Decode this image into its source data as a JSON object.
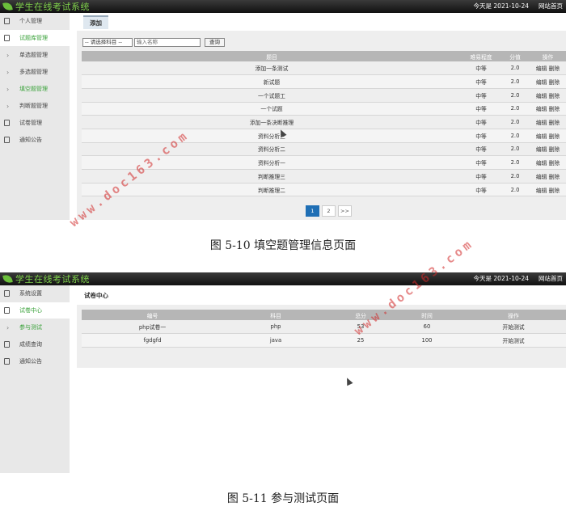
{
  "screen1": {
    "brand": "学生在线考试系统",
    "date_text": "今天是 2021-10-24",
    "site_link": "网站首页",
    "sidebar": [
      {
        "label": "个人管理",
        "type": "group"
      },
      {
        "label": "试题库管理",
        "type": "group",
        "active": true
      },
      {
        "label": "单选题管理",
        "type": "sub"
      },
      {
        "label": "多选题管理",
        "type": "sub"
      },
      {
        "label": "填空题管理",
        "type": "sub",
        "active": true
      },
      {
        "label": "判断题管理",
        "type": "sub"
      },
      {
        "label": "试卷管理",
        "type": "group"
      },
      {
        "label": "通知公告",
        "type": "group"
      }
    ],
    "tab_label": "添加",
    "search": {
      "select_value": "-- 请选择科目 --",
      "input_placeholder": "输入名称",
      "button_label": "查询"
    },
    "table": {
      "headers": [
        "题目",
        "难易程度",
        "分值",
        "操作"
      ],
      "edit_label": "编辑",
      "delete_label": "删除",
      "rows": [
        [
          "添加一条测试",
          "中等",
          "2.0"
        ],
        [
          "新试题",
          "中等",
          "2.0"
        ],
        [
          "一个试题工",
          "中等",
          "2.0"
        ],
        [
          "一个试题",
          "中等",
          "2.0"
        ],
        [
          "添加一条决断推理",
          "中等",
          "2.0"
        ],
        [
          "资料分析三",
          "中等",
          "2.0"
        ],
        [
          "资料分析二",
          "中等",
          "2.0"
        ],
        [
          "资料分析一",
          "中等",
          "2.0"
        ],
        [
          "判断推理三",
          "中等",
          "2.0"
        ],
        [
          "判断推理二",
          "中等",
          "2.0"
        ]
      ]
    },
    "pager": [
      "1",
      "2",
      ">>"
    ],
    "current_page": "1"
  },
  "caption1": "图 5-10 填空题管理信息页面",
  "screen2": {
    "brand": "学生在线考试系统",
    "date_text": "今天是 2021-10-24",
    "site_link": "网站首页",
    "sidebar": [
      {
        "label": "系统设置",
        "type": "group"
      },
      {
        "label": "试卷中心",
        "type": "group",
        "active": true
      },
      {
        "label": "参与测试",
        "type": "sub",
        "active": true
      },
      {
        "label": "成绩查询",
        "type": "group"
      },
      {
        "label": "通知公告",
        "type": "group"
      }
    ],
    "card_title": "试卷中心",
    "table": {
      "headers": [
        "编号",
        "科目",
        "总分",
        "时间",
        "操作"
      ],
      "rows": [
        [
          "php试卷一",
          "php",
          "53",
          "60",
          "开始测试"
        ],
        [
          "fgdgfd",
          "java",
          "25",
          "100",
          "开始测试"
        ]
      ]
    }
  },
  "caption2": "图 5-11 参与测试页面",
  "watermark": "www.doc163.com",
  "colors": {
    "accent_green": "#3aa23a",
    "pager_blue": "#1f6fb5",
    "watermark_red": "#d22828"
  }
}
